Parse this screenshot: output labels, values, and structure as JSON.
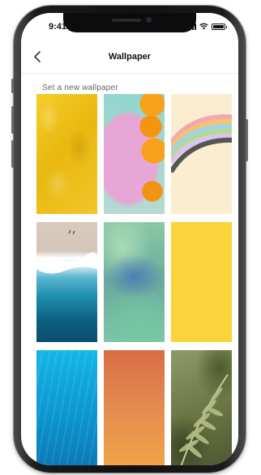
{
  "status_bar": {
    "time": "9:41"
  },
  "nav": {
    "title": "Wallpaper",
    "back_icon": "chevron-left-icon"
  },
  "section": {
    "label": "Set a new wallpaper"
  },
  "wallpapers": [
    {
      "name": "yellow-knit",
      "colors": [
        "#f5cd2b",
        "#e8b80f"
      ]
    },
    {
      "name": "pink-orange-abstract",
      "colors": [
        "#90d6cf",
        "#e7a6d6",
        "#f7a21a"
      ]
    },
    {
      "name": "rainbow-arc",
      "colors": [
        "#fbeed0",
        "#f2a7b5",
        "#f6c36a",
        "#9fd3e8",
        "#b7d88e",
        "#555555"
      ]
    },
    {
      "name": "aerial-wave",
      "colors": [
        "#d8cbbd",
        "#ffffff",
        "#1d8fae"
      ]
    },
    {
      "name": "green-blue-blur",
      "colors": [
        "#89c9a5",
        "#4d7fb5"
      ]
    },
    {
      "name": "solid-yellow",
      "colors": [
        "#fad43a"
      ]
    },
    {
      "name": "underwater-blue",
      "colors": [
        "#14b6e7",
        "#0a76b3"
      ]
    },
    {
      "name": "orange-gradient",
      "colors": [
        "#d86d43",
        "#f1a646"
      ]
    },
    {
      "name": "fern-leaf",
      "colors": [
        "#8f9a6a",
        "#4c5631"
      ]
    }
  ]
}
